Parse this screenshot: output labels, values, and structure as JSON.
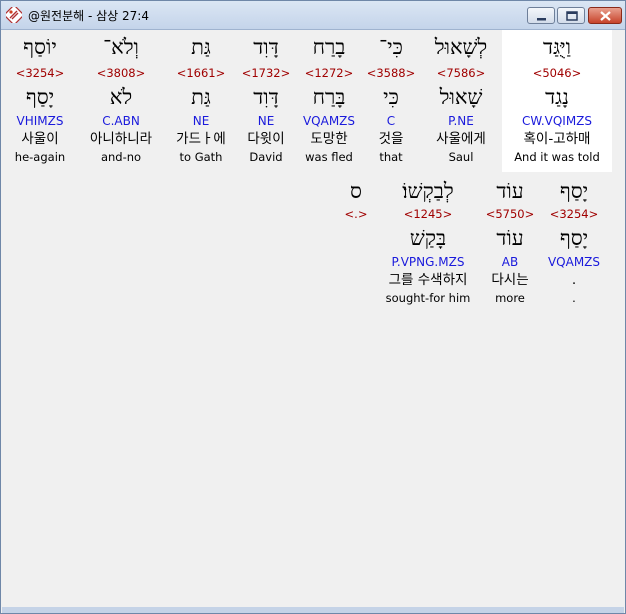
{
  "window": {
    "title": "@원전분해 - 삼상 27:4",
    "colors": {
      "strong": "#a00000",
      "parse": "#1a1adc",
      "highlight": "#ffffff"
    }
  },
  "row1": [
    {
      "heb": "וַיֻּגַּד",
      "strong": "<5046>",
      "parse": "CW.VQIMZS",
      "root": "נָגַד",
      "kor": "혹이-고하매",
      "eng": "And it was told",
      "highlight": true
    },
    {
      "heb": "לְשָׁאוּל",
      "strong": "<7586>",
      "parse": "P.NE",
      "root": "שָׁאוּל",
      "kor": "사울에게",
      "eng": "Saul"
    },
    {
      "heb": "כִּי־",
      "strong": "<3588>",
      "parse": "C",
      "root": "כִּי",
      "kor": "것을",
      "eng": "that"
    },
    {
      "heb": "בָרַח",
      "strong": "<1272>",
      "parse": "VQAMZS",
      "root": "בָּרַח",
      "kor": "도망한",
      "eng": "was fled"
    },
    {
      "heb": "דָּוִד",
      "strong": "<1732>",
      "parse": "NE",
      "root": "דָּוִד",
      "kor": "다윗이",
      "eng": "David"
    },
    {
      "heb": "גַּת",
      "strong": "<1661>",
      "parse": "NE",
      "root": "גַּת",
      "kor": "가드ㅏ에",
      "eng": "to Gath"
    },
    {
      "heb": "וְלֹא־",
      "strong": "<3808>",
      "parse": "C.ABN",
      "root": "לֹא",
      "kor": "아니하니라",
      "eng": "and-no"
    },
    {
      "heb": "יוֹסַף",
      "strong": "<3254>",
      "parse": "VHIMZS",
      "root": "יָסַף",
      "kor": "사울이",
      "eng": "he-again"
    }
  ],
  "row2": [
    {
      "heb": "יָסַף",
      "strong": "<3254>",
      "parse": "VQAMZS",
      "root": "יָסַף",
      "kor": ".",
      "eng": "."
    },
    {
      "heb": "עוֹד",
      "strong": "<5750>",
      "parse": "AB",
      "root": "עוֹד",
      "kor": "다시는",
      "eng": "more"
    },
    {
      "heb": "לְבַקְשׁוֹ׃",
      "strong": "<1245>",
      "parse": "P.VPNG.MZS",
      "root": "בָּקַשׁ",
      "kor": "그를 수색하지",
      "eng": "sought-for him"
    },
    {
      "heb": "ס",
      "strong": "<.>",
      "parse": "",
      "root": "",
      "kor": "",
      "eng": ""
    }
  ]
}
